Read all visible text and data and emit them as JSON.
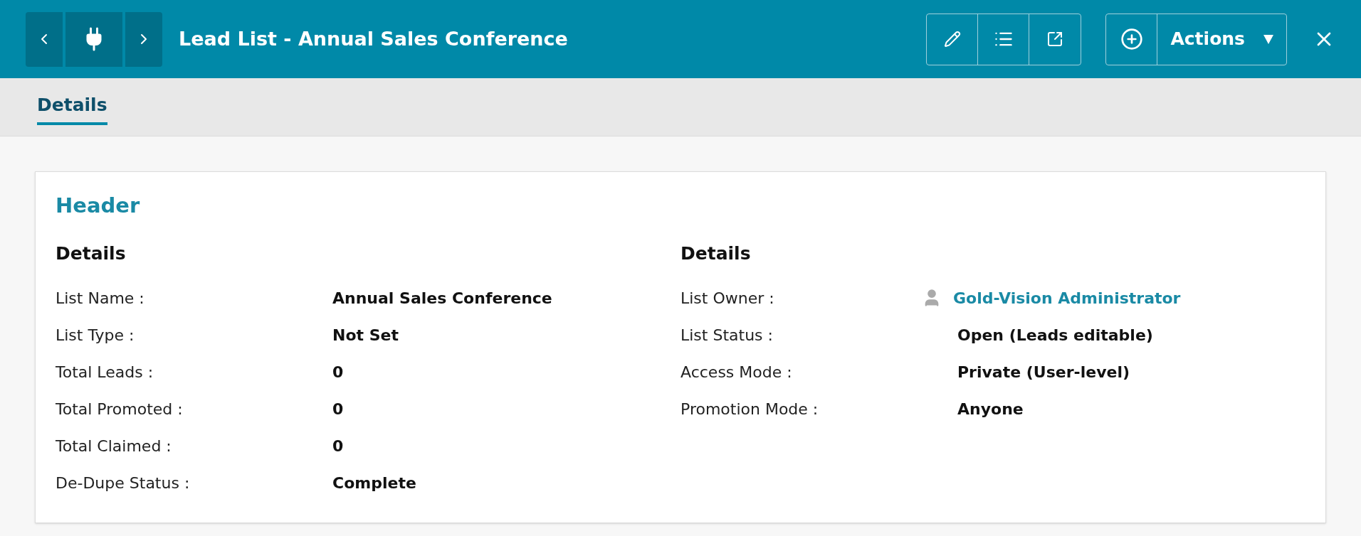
{
  "header": {
    "title": "Lead List - Annual Sales Conference",
    "actions_label": "Actions"
  },
  "tabs": [
    {
      "label": "Details",
      "selected": true
    }
  ],
  "card": {
    "title": "Header",
    "sections": [
      {
        "title": "Details",
        "rows": [
          {
            "kind": "text",
            "label": "List Name :",
            "value": "Annual Sales Conference"
          },
          {
            "kind": "text",
            "label": "List Type :",
            "value": "Not Set"
          },
          {
            "kind": "text",
            "label": "Total Leads :",
            "value": "0"
          },
          {
            "kind": "text",
            "label": "Total Promoted :",
            "value": "0"
          },
          {
            "kind": "text",
            "label": "Total Claimed :",
            "value": "0"
          },
          {
            "kind": "text",
            "label": "De-Dupe Status :",
            "value": "Complete"
          }
        ]
      },
      {
        "title": "Details",
        "rows": [
          {
            "kind": "user",
            "label": "List Owner :",
            "value": "Gold-Vision Administrator"
          },
          {
            "kind": "text",
            "label": "List Status :",
            "value": "Open (Leads editable)"
          },
          {
            "kind": "text",
            "label": "Access Mode :",
            "value": "Private (User-level)"
          },
          {
            "kind": "text",
            "label": "Promotion Mode :",
            "value": "Anyone"
          }
        ]
      }
    ]
  }
}
